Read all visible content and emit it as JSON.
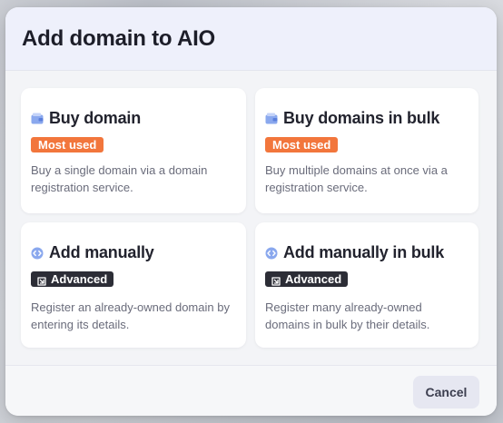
{
  "modal": {
    "title": "Add domain to AIO",
    "cancel_label": "Cancel"
  },
  "options": [
    {
      "title": "Buy domain",
      "icon": "wallet-icon",
      "badge": "Most used",
      "badge_color": "#f2763c",
      "description": "Buy a single domain via a domain registration service."
    },
    {
      "title": "Buy domains in bulk",
      "icon": "wallet-icon",
      "badge": "Most used",
      "badge_color": "#f2763c",
      "description": "Buy multiple domains at once via a registration service."
    },
    {
      "title": "Add manually",
      "icon": "code-icon",
      "badge": "Advanced",
      "badge_color": "#2c2d36",
      "description": "Register an already-owned domain by entering its details."
    },
    {
      "title": "Add manually in bulk",
      "icon": "code-icon",
      "badge": "Advanced",
      "badge_color": "#2c2d36",
      "description": "Register many already-owned domains in bulk by their details."
    }
  ]
}
